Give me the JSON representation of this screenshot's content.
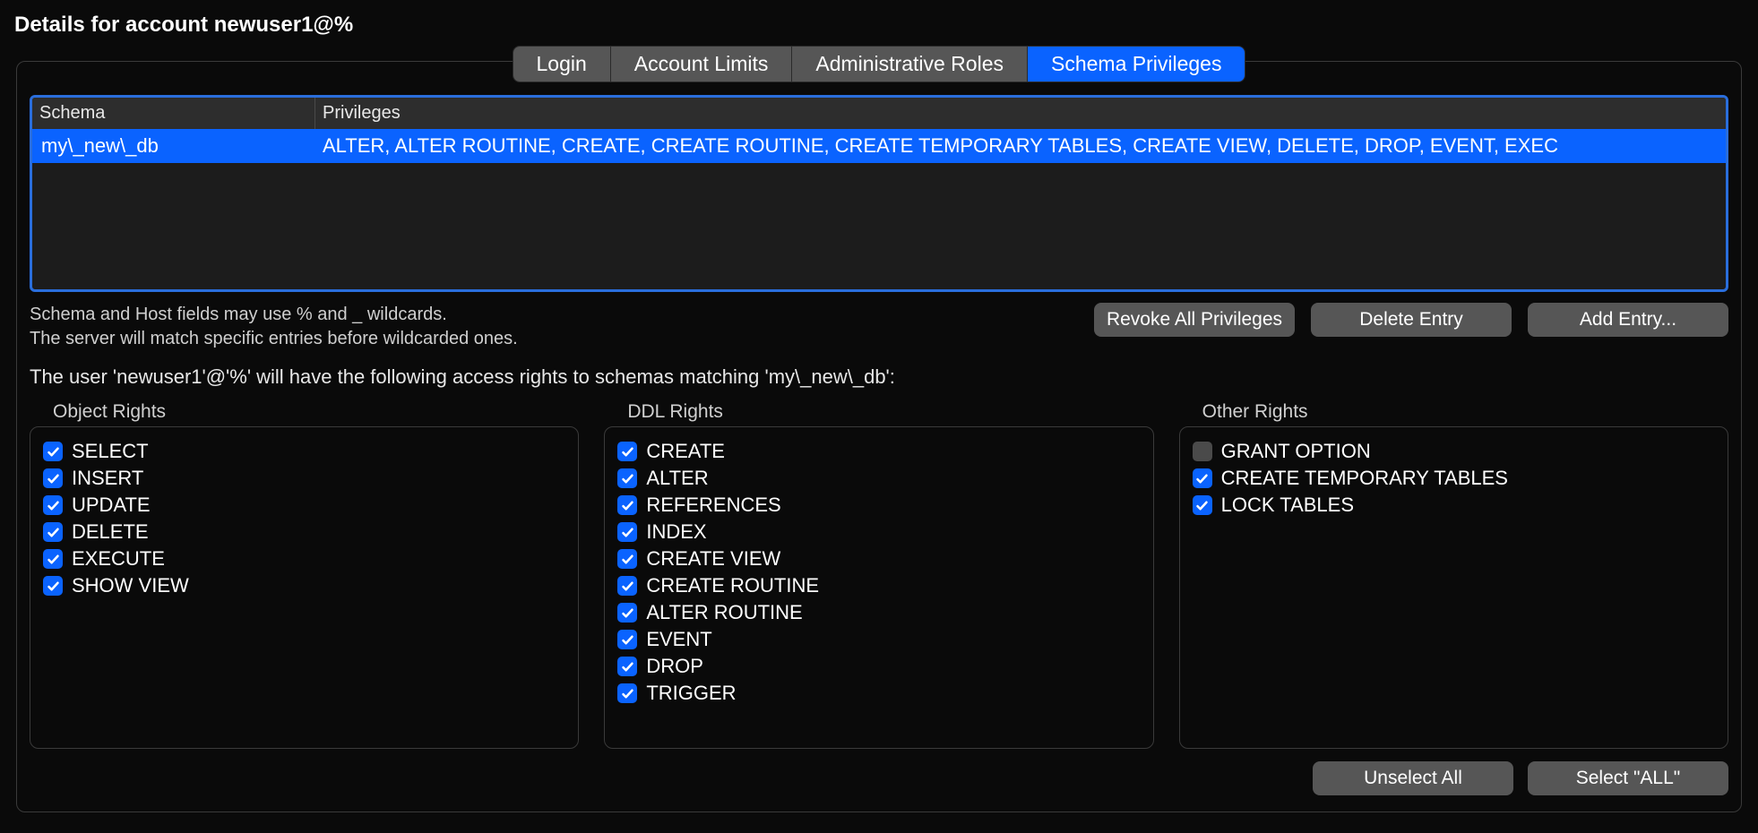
{
  "title": "Details for account newuser1@%",
  "tabs": [
    {
      "label": "Login",
      "active": false
    },
    {
      "label": "Account Limits",
      "active": false
    },
    {
      "label": "Administrative Roles",
      "active": false
    },
    {
      "label": "Schema Privileges",
      "active": true
    }
  ],
  "schema_table": {
    "headers": {
      "schema": "Schema",
      "privileges": "Privileges"
    },
    "rows": [
      {
        "schema": "my\\_new\\_db",
        "privileges": "ALTER, ALTER ROUTINE, CREATE, CREATE ROUTINE, CREATE TEMPORARY TABLES, CREATE VIEW, DELETE, DROP, EVENT, EXEC"
      }
    ]
  },
  "hint": {
    "line1": "Schema and Host fields may use % and _ wildcards.",
    "line2": "The server will match specific entries before wildcarded ones."
  },
  "buttons": {
    "revoke": "Revoke All Privileges",
    "delete": "Delete Entry",
    "add": "Add Entry...",
    "unselect": "Unselect All",
    "select_all": "Select \"ALL\""
  },
  "access_line": "The user 'newuser1'@'%' will have the following access rights to schemas matching 'my\\_new\\_db':",
  "rights": {
    "object": {
      "title": "Object Rights",
      "items": [
        {
          "label": "SELECT",
          "checked": true
        },
        {
          "label": "INSERT",
          "checked": true
        },
        {
          "label": "UPDATE",
          "checked": true
        },
        {
          "label": "DELETE",
          "checked": true
        },
        {
          "label": "EXECUTE",
          "checked": true
        },
        {
          "label": "SHOW VIEW",
          "checked": true
        }
      ]
    },
    "ddl": {
      "title": "DDL Rights",
      "items": [
        {
          "label": "CREATE",
          "checked": true
        },
        {
          "label": "ALTER",
          "checked": true
        },
        {
          "label": "REFERENCES",
          "checked": true
        },
        {
          "label": "INDEX",
          "checked": true
        },
        {
          "label": "CREATE VIEW",
          "checked": true
        },
        {
          "label": "CREATE ROUTINE",
          "checked": true
        },
        {
          "label": "ALTER ROUTINE",
          "checked": true
        },
        {
          "label": "EVENT",
          "checked": true
        },
        {
          "label": "DROP",
          "checked": true
        },
        {
          "label": "TRIGGER",
          "checked": true
        }
      ]
    },
    "other": {
      "title": "Other Rights",
      "items": [
        {
          "label": "GRANT OPTION",
          "checked": false
        },
        {
          "label": "CREATE TEMPORARY TABLES",
          "checked": true
        },
        {
          "label": "LOCK TABLES",
          "checked": true
        }
      ]
    }
  }
}
